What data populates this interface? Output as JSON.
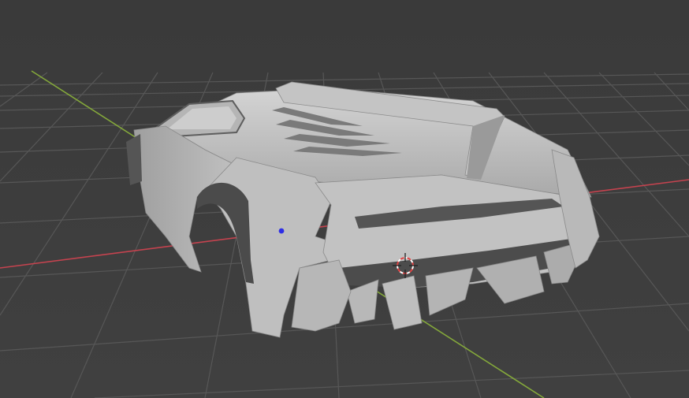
{
  "viewport": {
    "kind": "3d-viewport",
    "shading": "solid",
    "object": "sports-car-body-mesh"
  },
  "colors": {
    "background": "#3d3d3d",
    "grid_line": "#555555",
    "x_axis": "#c5434f",
    "y_axis": "#84a83b",
    "mesh_light": "#c9c9c9",
    "mesh_mid": "#a8a8a8",
    "mesh_dark": "#5a5a5a",
    "origin_dot": "#2e2ee6",
    "cursor_red": "#d44",
    "cursor_white": "#ffffff"
  },
  "icons": {
    "origin": "object-origin-dot-icon",
    "cursor": "3d-cursor-icon"
  }
}
